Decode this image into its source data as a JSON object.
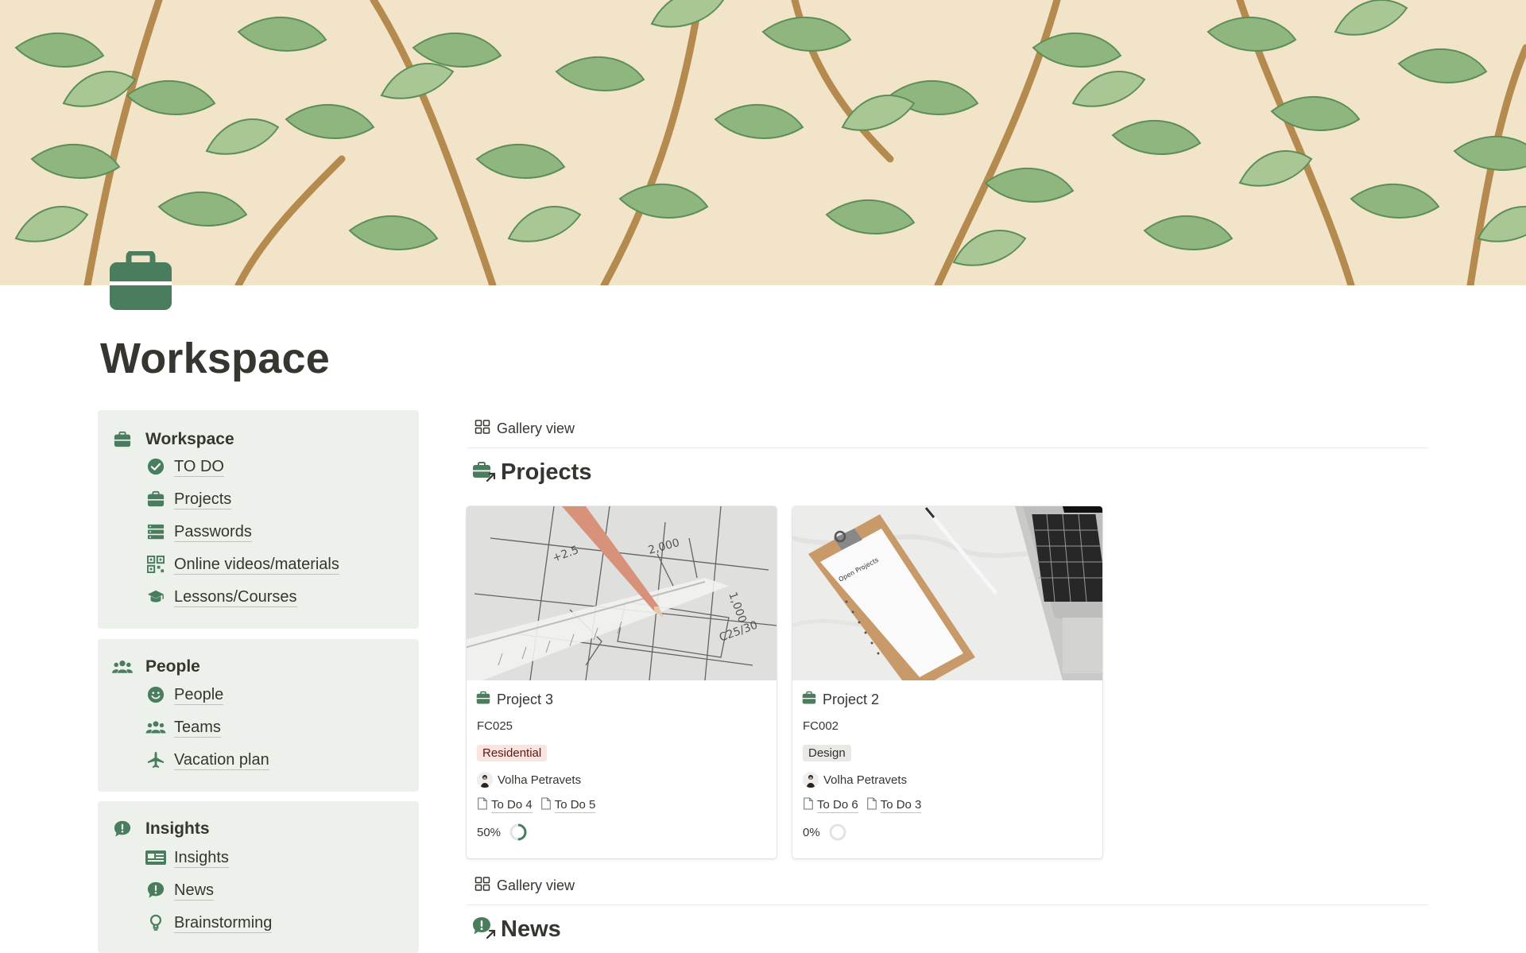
{
  "page": {
    "title": "Workspace",
    "icon": "briefcase-icon",
    "accent_color": "#4a7d5e"
  },
  "nav": {
    "workspace": {
      "title": "Workspace",
      "icon": "briefcase-icon",
      "items": [
        {
          "label": "TO DO",
          "icon": "check-circle-icon"
        },
        {
          "label": "Projects",
          "icon": "briefcase-icon"
        },
        {
          "label": "Passwords",
          "icon": "server-icon"
        },
        {
          "label": "Online videos/materials",
          "icon": "qr-code-icon"
        },
        {
          "label": "Lessons/Courses",
          "icon": "graduation-cap-icon"
        }
      ]
    },
    "people": {
      "title": "People",
      "icon": "group-icon",
      "items": [
        {
          "label": "People",
          "icon": "smiley-icon"
        },
        {
          "label": "Teams",
          "icon": "group-icon"
        },
        {
          "label": "Vacation plan",
          "icon": "airplane-icon"
        }
      ]
    },
    "insights": {
      "title": "Insights",
      "icon": "exclamation-bubble-icon",
      "items": [
        {
          "label": "Insights",
          "icon": "id-card-icon"
        },
        {
          "label": "News",
          "icon": "exclamation-bubble-icon"
        },
        {
          "label": "Brainstorming",
          "icon": "lightbulb-icon"
        }
      ]
    }
  },
  "projects_view": {
    "view_label": "Gallery view",
    "title": "Projects",
    "cards": [
      {
        "title": "Project 3",
        "code": "FC025",
        "tag": "Residential",
        "tag_bg": "#fbe4e0",
        "tag_color": "#5d1715",
        "person": "Volha Petravets",
        "relations": [
          "To Do 4",
          "To Do 5"
        ],
        "progress_label": "50%",
        "progress": 0.5,
        "cover": "blueprint-pencil"
      },
      {
        "title": "Project 2",
        "code": "FC002",
        "tag": "Design",
        "tag_bg": "#e9e8e5",
        "tag_color": "#32302c",
        "person": "Volha Petravets",
        "relations": [
          "To Do 6",
          "To Do 3"
        ],
        "progress_label": "0%",
        "progress": 0,
        "cover": "clipboard-laptop",
        "clipboard_text": "Open Projects"
      }
    ]
  },
  "news_view": {
    "view_label": "Gallery view",
    "title": "News"
  }
}
